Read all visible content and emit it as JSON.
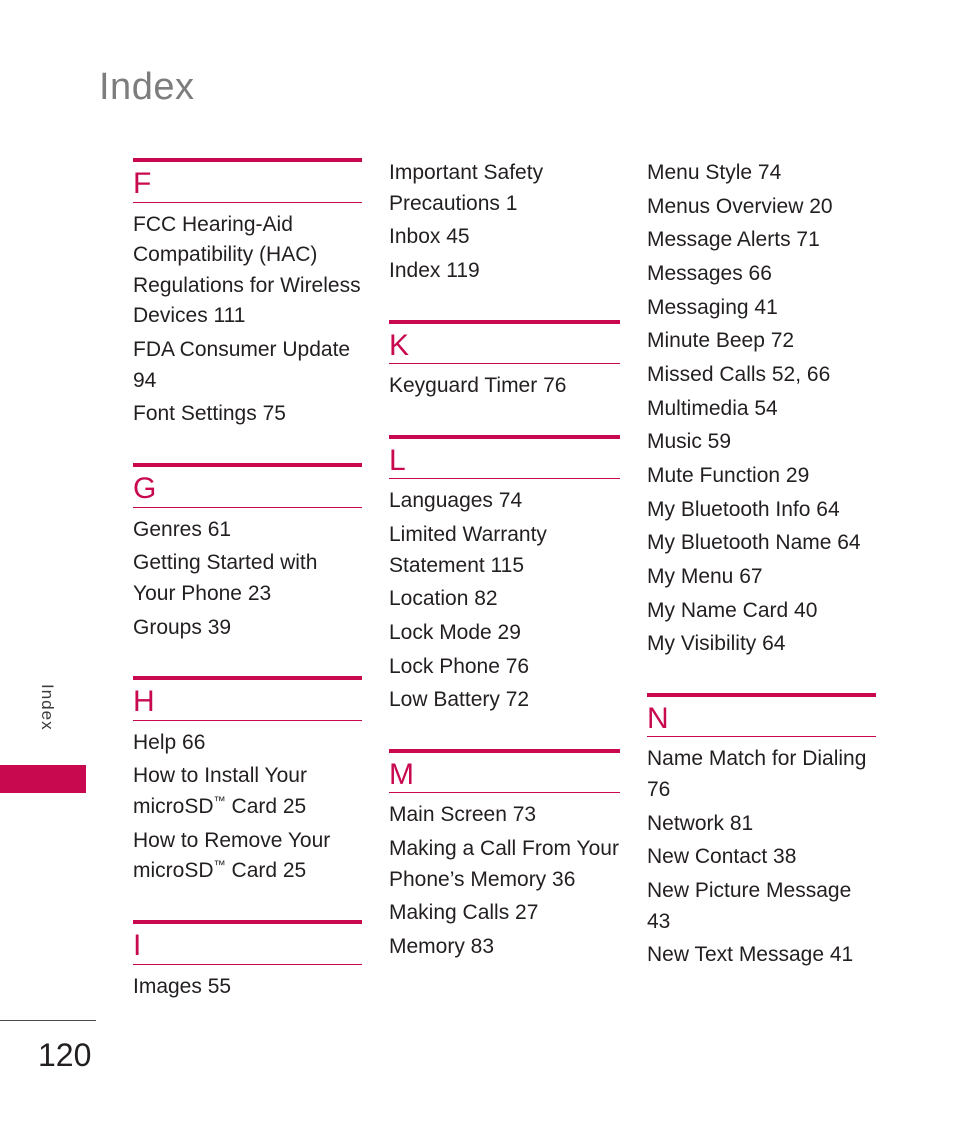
{
  "page": {
    "title": "Index",
    "side_tab_label": "Index",
    "page_number": "120",
    "accent_color": "#c8084f",
    "title_color": "#7d7d7d",
    "text_color": "#231f20"
  },
  "columns": [
    {
      "name": "column-1",
      "blocks": [
        {
          "type": "section",
          "letter": "F",
          "entries": [
            "FCC Hearing-Aid Compatibility (HAC) Regulations for Wireless Devices 111",
            "FDA Consumer Update 94",
            "Font Settings 75"
          ]
        },
        {
          "type": "section",
          "letter": "G",
          "entries": [
            "Genres 61",
            "Getting Started with Your Phone 23",
            "Groups 39"
          ]
        },
        {
          "type": "section",
          "letter": "H",
          "entries": [
            "Help 66",
            "How to Install Your microSD™ Card 25",
            "How to Remove Your microSD™ Card 25"
          ]
        },
        {
          "type": "section",
          "letter": "I",
          "entries": [
            "Images 55"
          ]
        }
      ]
    },
    {
      "name": "column-2",
      "blocks": [
        {
          "type": "continuation",
          "letter": "",
          "entries": [
            "Important Safety Precautions 1",
            "Inbox 45",
            "Index 119"
          ]
        },
        {
          "type": "section",
          "letter": "K",
          "entries": [
            "Keyguard Timer 76"
          ]
        },
        {
          "type": "section",
          "letter": "L",
          "entries": [
            "Languages 74",
            "Limited Warranty Statement 115",
            "Location 82",
            "Lock Mode 29",
            "Lock Phone 76",
            "Low Battery 72"
          ]
        },
        {
          "type": "section",
          "letter": "M",
          "entries": [
            "Main Screen 73",
            "Making a Call From Your Phone’s Memory 36",
            "Making Calls 27",
            "Memory 83"
          ]
        }
      ]
    },
    {
      "name": "column-3",
      "blocks": [
        {
          "type": "continuation",
          "letter": "",
          "entries": [
            "Menu Style 74",
            "Menus Overview 20",
            "Message Alerts 71",
            "Messages 66",
            "Messaging 41",
            "Minute Beep 72",
            "Missed Calls 52, 66",
            "Multimedia 54",
            "Music 59",
            "Mute Function 29",
            "My Bluetooth Info 64",
            "My Bluetooth Name 64",
            "My Menu 67",
            "My Name Card 40",
            "My Visibility 64"
          ]
        },
        {
          "type": "section",
          "letter": "N",
          "entries": [
            "Name Match for Dialing 76",
            "Network 81",
            "New Contact 38",
            "New Picture Message 43",
            "New Text Message 41"
          ]
        }
      ]
    }
  ]
}
